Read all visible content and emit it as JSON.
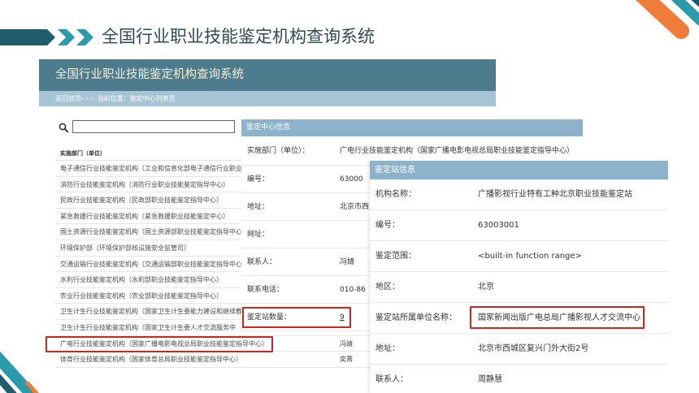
{
  "slide": {
    "title": "全国行业职业技能鉴定机构查询系统"
  },
  "site": {
    "title": "全国行业职业技能鉴定机构查询系统",
    "breadcrumb": {
      "home": "返回首页",
      "separator": "› › ›",
      "location": "当前位置：鉴定中心列表页"
    }
  },
  "search": {
    "icon": "search-icon"
  },
  "list": {
    "header": "实施部门（单位）",
    "items": [
      {
        "name": "电子通信行业技能鉴定机构（工业和信息化部电子通信行业职业"
      },
      {
        "name": "消防行业技能鉴定机构（消防行业职业技能鉴定指导中心）"
      },
      {
        "name": "民政行业技能鉴定机构（民政部职业技能鉴定指导中心）"
      },
      {
        "name": "紧急救援行业技能鉴定机构（紧急救援职业技能鉴定中心）"
      },
      {
        "name": "国土资源行业技能鉴定机构（国土资源部职业技能鉴定指导中心"
      },
      {
        "name": "环境保护部（环境保护部核设施安全监管司）"
      },
      {
        "name": "交通运输行业技能鉴定机构（交通运输部职业技能鉴定指导中心"
      },
      {
        "name": "水利行业技能鉴定机构（水利部职业技能鉴定指导中心）"
      },
      {
        "name": "农业行业技能鉴定机构（农业部职业技能鉴定指导中心）"
      },
      {
        "name": "卫生计生行业技能鉴定机构（国家卫生计生委能力建设和继续教"
      },
      {
        "name": "卫生计生行业技能鉴定机构（国家卫生计生委人才交流服务中"
      },
      {
        "name": "广电行业技能鉴定机构（国家广播电影电视总局职业技能鉴定指导中心）",
        "contact": "冯婧",
        "highlighted": true
      },
      {
        "name": "体育行业技能鉴定机构（国家体育总局职业技能鉴定指导中心）",
        "contact": "奕菁"
      }
    ]
  },
  "center_info": {
    "title": "鉴定中心信息",
    "rows": [
      {
        "label": "实施部门（单位）：",
        "value": "广电行业技能鉴定机构（国家广播电影电视总局职业技能鉴定指导中心）"
      },
      {
        "label": "编号：",
        "value": "63000"
      },
      {
        "label": "地址：",
        "value": "北京市西"
      },
      {
        "label": "网址："
      },
      {
        "label": "联系人：",
        "value": "冯婧"
      },
      {
        "label": "联系电话：",
        "value": "010-86"
      },
      {
        "label": "鉴定站数量：",
        "value": "9",
        "highlighted": true
      }
    ]
  },
  "station_info": {
    "title": "鉴定站信息",
    "rows": [
      {
        "label": "机构名称：",
        "value": "广播影视行业特有工种北京职业技能鉴定站"
      },
      {
        "label": "编号：",
        "value": "63003001"
      },
      {
        "label": "鉴定范围：",
        "value": "<built-in function range>"
      },
      {
        "label": "地区：",
        "value": "北京"
      },
      {
        "label": "鉴定站所属单位名称：",
        "value": "国家新闻出版广电总局广播影视人才交流中心",
        "highlighted": true
      },
      {
        "label": "地址：",
        "value": "北京市西城区复兴门外大街2号"
      },
      {
        "label": "联系人：",
        "value": "周静慧"
      }
    ]
  },
  "colors": {
    "slide_title": "#2e4a57",
    "site_header": "#4c7c8e",
    "site_title_text": "#f4efd6",
    "breadcrumb_bar": "#a6c4d6",
    "panel_header": "#8cb3cb",
    "highlight_box": "#c8281e",
    "decor_orange": "#f07c3c",
    "decor_teal": "#2b9aab",
    "decor_dark": "#1f5d6c"
  }
}
